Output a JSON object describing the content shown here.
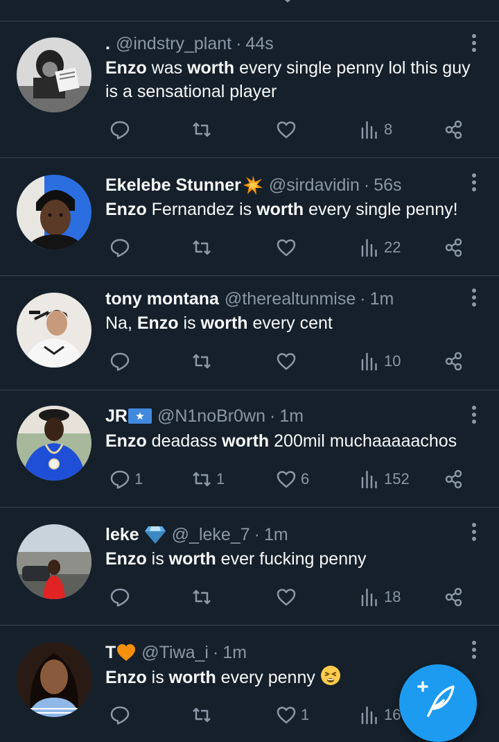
{
  "colors": {
    "background": "#15202b",
    "divider": "#38444d",
    "muted": "#8b98a5",
    "accent": "#1d9bf0"
  },
  "top_partial": {
    "icons": [
      "reply-icon",
      "retweet-icon",
      "like-icon",
      "views-icon",
      "share-icon"
    ]
  },
  "tweets": [
    {
      "name": ".",
      "handle": "@indstry_plant",
      "time": "44s",
      "avatar": "avatar-chimp-reading",
      "body": [
        {
          "text": "Enzo",
          "bold": true
        },
        {
          "text": " was ",
          "bold": false
        },
        {
          "text": "worth",
          "bold": true
        },
        {
          "text": " every single penny lol this guy is a sensational player",
          "bold": false
        }
      ],
      "replies": "",
      "retweets": "",
      "likes": "",
      "views": "8"
    },
    {
      "name": "Ekelebe Stunner",
      "name_emoji": "collision-emoji",
      "handle": "@sirdavidin",
      "time": "56s",
      "avatar": "avatar-man-selfie",
      "body": [
        {
          "text": "Enzo",
          "bold": true
        },
        {
          "text": " Fernandez is ",
          "bold": false
        },
        {
          "text": "worth",
          "bold": true
        },
        {
          "text": " every single penny!",
          "bold": false
        }
      ],
      "replies": "",
      "retweets": "",
      "likes": "",
      "views": "22"
    },
    {
      "name": "tony montana",
      "handle": "@therealtunmise",
      "time": "1m",
      "avatar": "avatar-scarface",
      "body": [
        {
          "text": "Na, ",
          "bold": false
        },
        {
          "text": "Enzo",
          "bold": true
        },
        {
          "text": " is ",
          "bold": false
        },
        {
          "text": "worth",
          "bold": true
        },
        {
          "text": " every cent",
          "bold": false
        }
      ],
      "replies": "",
      "retweets": "",
      "likes": "",
      "views": "10"
    },
    {
      "name": "JR",
      "name_emoji": "somalia-flag-emoji",
      "handle": "@N1noBr0wn",
      "time": "1m",
      "avatar": "avatar-blue-outfit",
      "body": [
        {
          "text": "Enzo",
          "bold": true
        },
        {
          "text": " deadass ",
          "bold": false
        },
        {
          "text": "worth",
          "bold": true
        },
        {
          "text": " 200mil muchaaaaachos",
          "bold": false
        }
      ],
      "replies": "1",
      "retweets": "1",
      "likes": "6",
      "views": "152"
    },
    {
      "name": "leke",
      "name_emoji": "gem-emoji",
      "handle": "@_leke_7",
      "time": "1m",
      "avatar": "avatar-red-shirt",
      "body": [
        {
          "text": "Enzo",
          "bold": true
        },
        {
          "text": " is ",
          "bold": false
        },
        {
          "text": "worth",
          "bold": true
        },
        {
          "text": " ever fucking penny",
          "bold": false
        }
      ],
      "replies": "",
      "retweets": "",
      "likes": "",
      "views": "18"
    },
    {
      "name": "T",
      "name_emoji": "orange-heart-emoji",
      "handle": "@Tiwa_i",
      "time": "1m",
      "avatar": "avatar-woman",
      "body": [
        {
          "text": "Enzo",
          "bold": true
        },
        {
          "text": " is ",
          "bold": false
        },
        {
          "text": "worth",
          "bold": true
        },
        {
          "text": " every penny",
          "bold": false
        }
      ],
      "body_emoji": "tired-face-emoji",
      "replies": "",
      "retweets": "",
      "likes": "1",
      "views": "16"
    }
  ],
  "fab": {
    "icon": "compose-feather-icon"
  }
}
